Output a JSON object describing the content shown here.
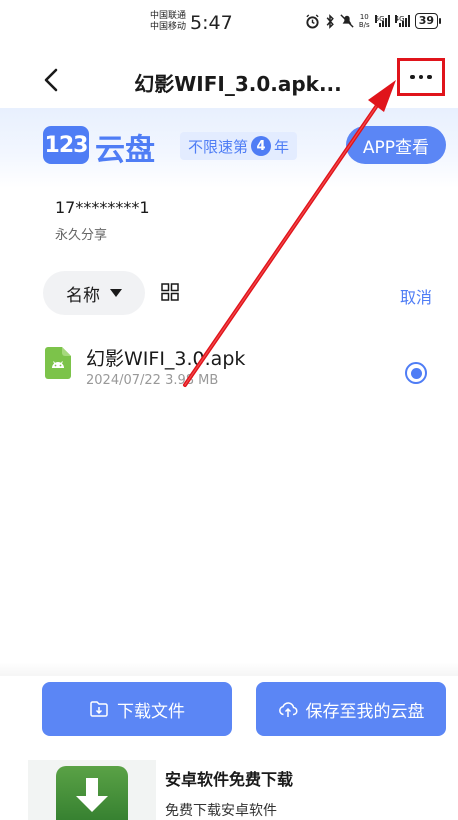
{
  "status_bar": {
    "carrier_1": "中国联通",
    "carrier_2": "中国移动",
    "time": "5:47",
    "net_speed_value": "10",
    "net_speed_unit": "B/s",
    "sig1_label": "5G",
    "sig2_label": "4G",
    "battery": "39"
  },
  "header": {
    "title": "幻影WIFI_3.0.apk..."
  },
  "banner": {
    "logo_mark": "123",
    "logo_text": "云盘",
    "tag_prefix": "不限速第",
    "tag_number": "4",
    "tag_suffix": "年",
    "app_button": "APP查看"
  },
  "share": {
    "owner": "17********1",
    "type": "永久分享"
  },
  "toolbar": {
    "sort_label": "名称",
    "cancel_label": "取消"
  },
  "files": [
    {
      "name": "幻影WIFI_3.0.apk",
      "date": "2024/07/22",
      "size": "3.98 MB"
    }
  ],
  "actions": {
    "download": "下载文件",
    "save": "保存至我的云盘"
  },
  "ad": {
    "title": "安卓软件免费下载",
    "subtitle": "免费下载安卓软件"
  },
  "colors": {
    "accent": "#4f7df5",
    "button": "#5b86f5",
    "annotation": "#e0141b",
    "apk_icon": "#7cc34a"
  }
}
